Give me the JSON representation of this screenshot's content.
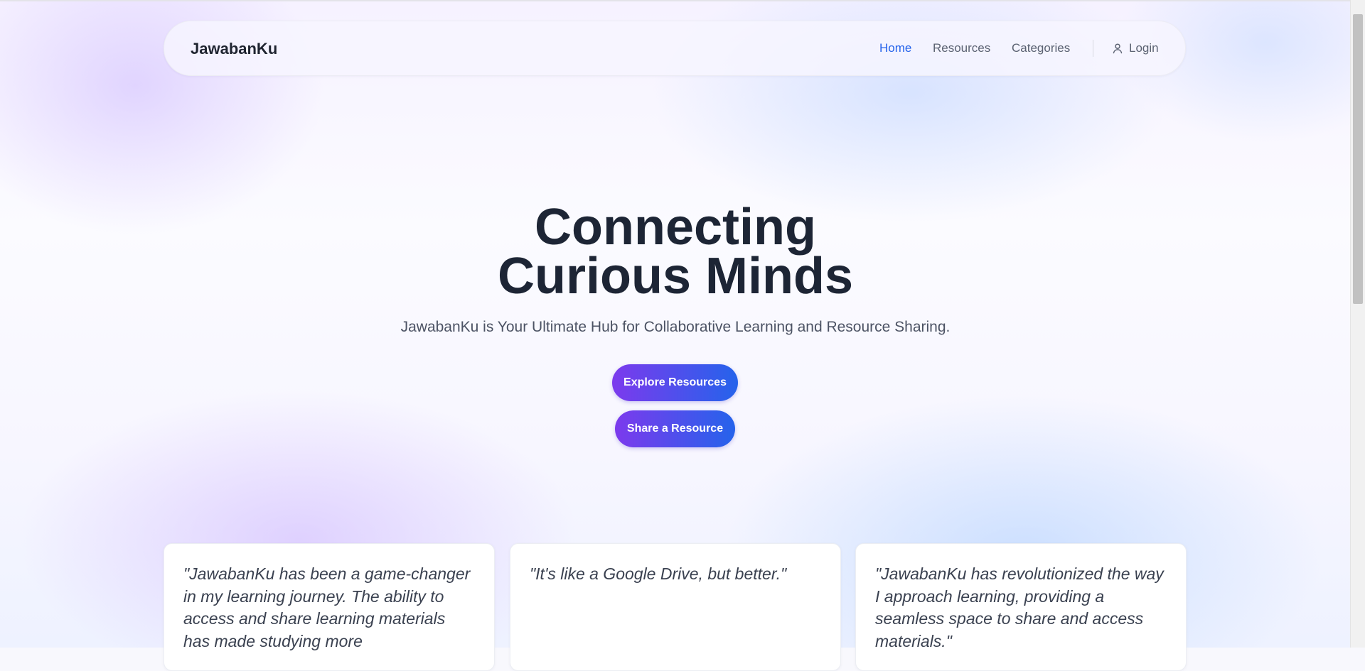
{
  "nav": {
    "brand": "JawabanKu",
    "links": [
      {
        "label": "Home",
        "active": true
      },
      {
        "label": "Resources",
        "active": false
      },
      {
        "label": "Categories",
        "active": false
      }
    ],
    "login_label": "Login",
    "login_icon": "user-icon"
  },
  "hero": {
    "title_line1": "Connecting",
    "title_line2": "Curious Minds",
    "subtitle": "JawabanKu is Your Ultimate Hub for Collaborative Learning and Resource Sharing.",
    "primary_button": "Explore Resources",
    "secondary_button": "Share a Resource"
  },
  "testimonials": [
    {
      "quote": "\"JawabanKu has been a game-changer in my learning journey. The ability to access and share learning materials has made studying more"
    },
    {
      "quote": "\"It's like a Google Drive, but better.\""
    },
    {
      "quote": "\"JawabanKu has revolutionized the way I approach learning, providing a seamless space to share and access materials.\""
    }
  ],
  "colors": {
    "accent": "#2563eb",
    "gradient_start": "#7c3aed",
    "gradient_end": "#2563eb",
    "heading": "#1d2535"
  }
}
